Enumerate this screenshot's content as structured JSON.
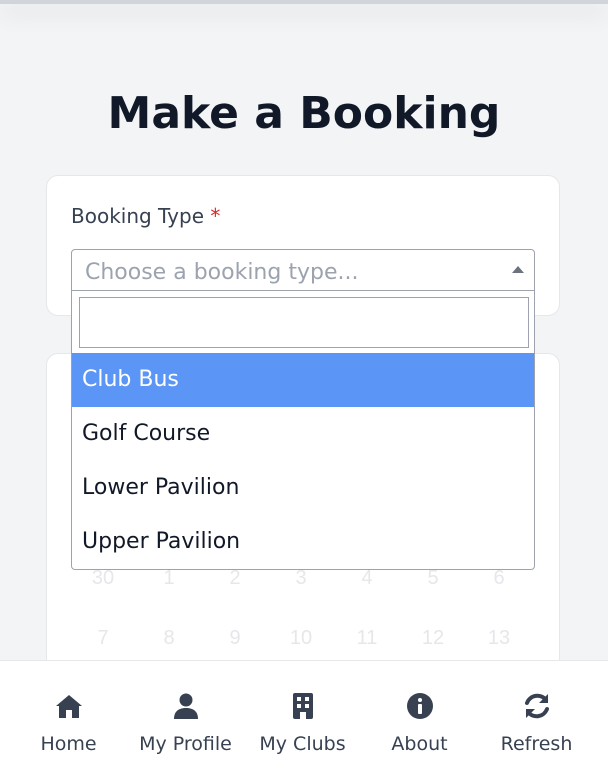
{
  "page": {
    "title": "Make a Booking"
  },
  "booking_form": {
    "booking_type_label": "Booking Type",
    "required_marker": "*",
    "select_placeholder": "Choose a booking type...",
    "search_value": "",
    "options": [
      "Club Bus",
      "Golf Course",
      "Lower Pavilion",
      "Upper Pavilion"
    ],
    "highlighted_option": "Club Bus"
  },
  "calendar": {
    "week_1": [
      "30",
      "1",
      "2",
      "3",
      "4",
      "5",
      "6"
    ],
    "week_2": [
      "7",
      "8",
      "9",
      "10",
      "11",
      "12",
      "13"
    ]
  },
  "bottom_nav": {
    "items": [
      {
        "label": "Home",
        "icon": "home-icon"
      },
      {
        "label": "My Profile",
        "icon": "user-icon"
      },
      {
        "label": "My Clubs",
        "icon": "building-icon"
      },
      {
        "label": "About",
        "icon": "info-icon"
      },
      {
        "label": "Refresh",
        "icon": "refresh-icon"
      }
    ]
  },
  "colors": {
    "highlight": "#5b96f7",
    "required": "#dc2626",
    "icon": "#374151"
  }
}
